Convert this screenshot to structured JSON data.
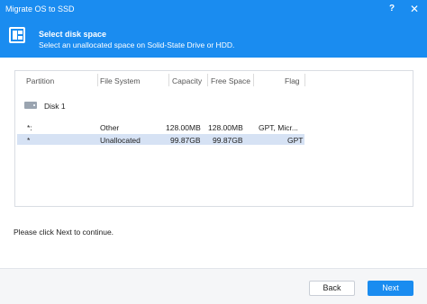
{
  "window": {
    "title": "Migrate OS to SSD",
    "help_glyph": "?",
    "close_glyph": "✕"
  },
  "header": {
    "title": "Select disk space",
    "subtitle": "Select an unallocated space on Solid-State Drive or HDD.",
    "icon": "migrate-icon"
  },
  "table": {
    "columns": [
      "Partition",
      "File System",
      "Capacity",
      "Free Space",
      "Flag"
    ],
    "disk": {
      "label": "Disk 1",
      "icon": "disk-icon"
    },
    "rows": [
      {
        "partition": "*:",
        "file_system": "Other",
        "capacity": "128.00MB",
        "free_space": "128.00MB",
        "flag": "GPT, Micr..."
      },
      {
        "partition": "*",
        "file_system": "Unallocated",
        "capacity": "99.87GB",
        "free_space": "99.87GB",
        "flag": "GPT"
      }
    ],
    "selected_row": 1
  },
  "status_text": "Please click Next to continue.",
  "buttons": {
    "back": "Back",
    "next": "Next"
  },
  "colors": {
    "accent": "#1a8cf0",
    "selection": "#d6e2f4"
  }
}
